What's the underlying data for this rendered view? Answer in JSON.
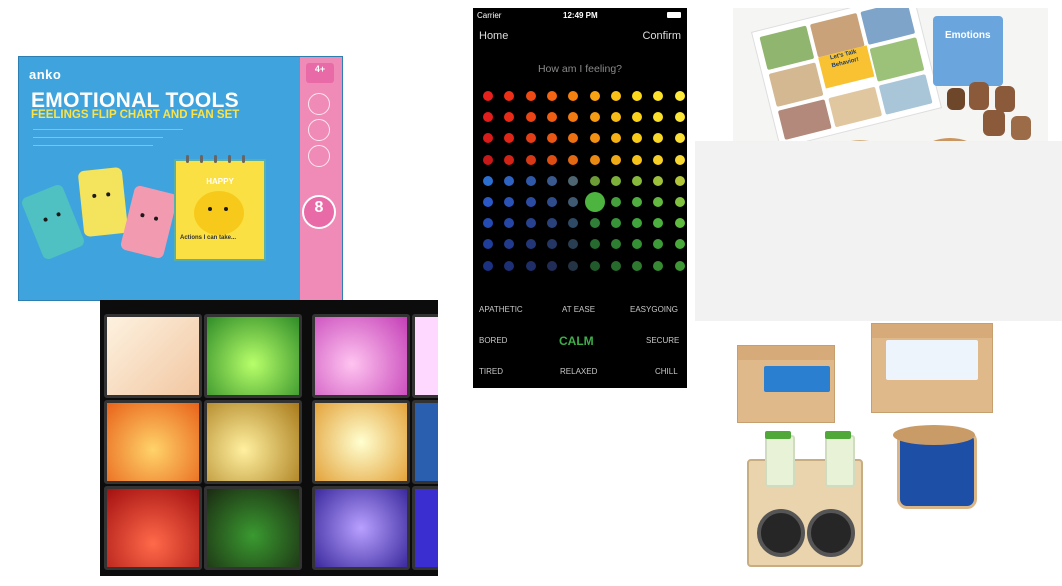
{
  "anko": {
    "brand": "anko",
    "title": "EMOTIONAL TOOLS",
    "subtitle": "FEELINGS FLIP CHART AND FAN SET",
    "age": "4+",
    "card_count": "8",
    "flip_label": "HAPPY",
    "actions": "Actions I can take..."
  },
  "phone": {
    "carrier": "Carrier",
    "time": "12:49 PM",
    "nav_home": "Home",
    "nav_confirm": "Confirm",
    "prompt": "How am I feeling?",
    "moods": {
      "apathetic": "APATHETIC",
      "at_ease": "AT EASE",
      "easygoing": "EASYGOING",
      "bored": "BORED",
      "calm": "CALM",
      "secure": "SECURE",
      "tired": "TIRED",
      "relaxed": "RELAXED",
      "chill": "CHILL"
    }
  },
  "stones": {
    "book_title": "Let's Talk Behavior!",
    "box_label": "Emotions"
  }
}
